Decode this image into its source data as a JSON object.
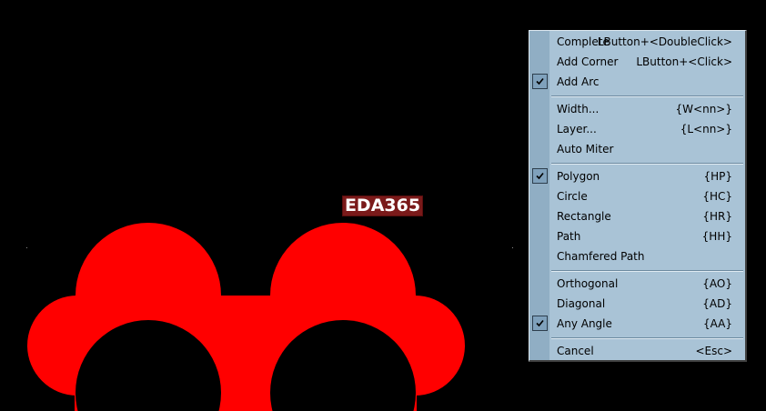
{
  "board": {
    "watermark_text": "EDA365",
    "shape_color": "#ff0000",
    "background_color": "#000000"
  },
  "context_menu": {
    "items": [
      {
        "label": "Complete",
        "shortcut": "LButton+<DoubleClick>",
        "checked": false
      },
      {
        "label": "Add Corner",
        "shortcut": "LButton+<Click>",
        "checked": false
      },
      {
        "label": "Add Arc",
        "shortcut": "",
        "checked": true
      },
      {
        "label": "Width...",
        "shortcut": "{W<nn>}",
        "checked": false
      },
      {
        "label": "Layer...",
        "shortcut": "{L<nn>}",
        "checked": false
      },
      {
        "label": "Auto Miter",
        "shortcut": "",
        "checked": false
      },
      {
        "label": "Polygon",
        "shortcut": "{HP}",
        "checked": true
      },
      {
        "label": "Circle",
        "shortcut": "{HC}",
        "checked": false
      },
      {
        "label": "Rectangle",
        "shortcut": "{HR}",
        "checked": false
      },
      {
        "label": "Path",
        "shortcut": "{HH}",
        "checked": false
      },
      {
        "label": "Chamfered Path",
        "shortcut": "",
        "checked": false
      },
      {
        "label": "Orthogonal",
        "shortcut": "{AO}",
        "checked": false
      },
      {
        "label": "Diagonal",
        "shortcut": "{AD}",
        "checked": false
      },
      {
        "label": "Any Angle",
        "shortcut": "{AA}",
        "checked": true
      },
      {
        "label": "Cancel",
        "shortcut": "<Esc>",
        "checked": false
      }
    ],
    "icons": {
      "check": "checkmark-icon"
    },
    "colors": {
      "menu_bg": "#a9c3d6",
      "gutter_bg": "#90aec4",
      "check_bg": "#7fa1bc"
    }
  }
}
